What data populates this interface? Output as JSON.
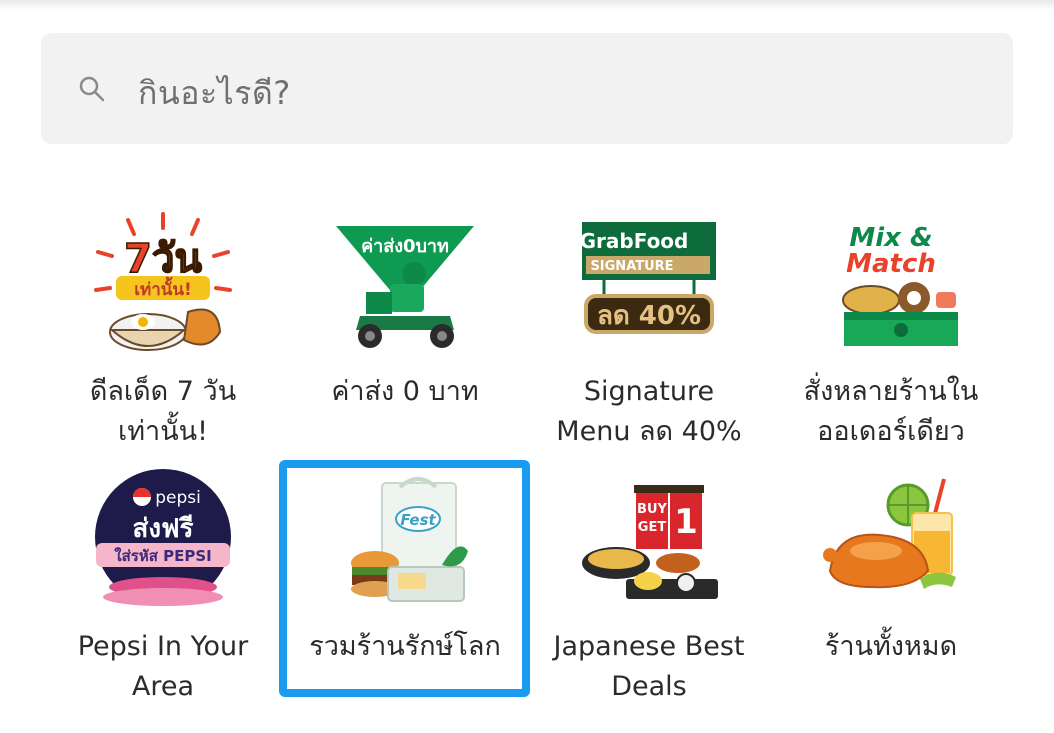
{
  "search": {
    "placeholder": "กินอะไรดี?"
  },
  "categories": [
    {
      "label_line1": "ดีลเด็ด 7 วัน",
      "label_line2": "เท่านั้น!",
      "art_text_1": "7วัน",
      "art_text_2": "เท่านั้น!"
    },
    {
      "label_line1": "ค่าส่ง 0 บาท",
      "label_line2": "",
      "art_text_1": "ค่าส่ง0บาท"
    },
    {
      "label_line1": "Signature",
      "label_line2": "Menu ลด 40%",
      "art_text_1": "GrabFood",
      "art_text_2": "SIGNATURE",
      "art_text_3": "ลด 40%"
    },
    {
      "label_line1": "สั่งหลายร้านใน",
      "label_line2": "ออเดอร์เดียว",
      "art_text_1": "Mix &",
      "art_text_2": "Match"
    },
    {
      "label_line1": "Pepsi In Your",
      "label_line2": "Area",
      "art_text_1": "pepsi",
      "art_text_2": "ส่งฟรี",
      "art_text_3": "ใส่รหัส PEPSI"
    },
    {
      "label_line1": "รวมร้านรักษ์โลก",
      "label_line2": "",
      "art_text_1": "Fest"
    },
    {
      "label_line1": "Japanese Best",
      "label_line2": "Deals",
      "art_text_1": "BUY",
      "art_text_2": "GET",
      "art_text_3": "1"
    },
    {
      "label_line1": "ร้านทั้งหมด",
      "label_line2": ""
    }
  ],
  "colors": {
    "selection_border": "#1a9bf0",
    "grab_green": "#00a84f",
    "search_bg": "#f2f2f2"
  }
}
